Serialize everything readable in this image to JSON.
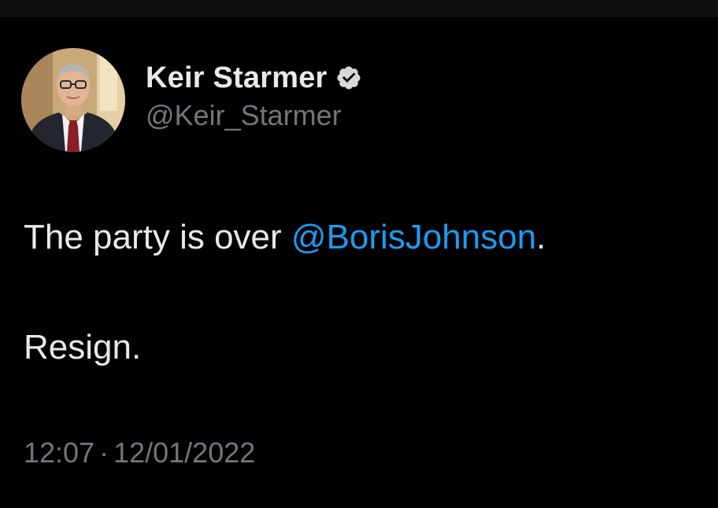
{
  "tweet": {
    "author": {
      "display_name": "Keir Starmer",
      "handle": "@Keir_Starmer",
      "verified": true,
      "avatar": "profile-photo"
    },
    "text": {
      "line1_prefix": "The party is over ",
      "mention": "@BorisJohnson",
      "line1_suffix": ".",
      "line2": "Resign."
    },
    "meta": {
      "time": "12:07",
      "separator": "·",
      "date": "12/01/2022"
    }
  },
  "colors": {
    "background": "#000000",
    "text": "#e7e9ea",
    "secondary": "#71767b",
    "link": "#1d9bf0",
    "verified_badge": "#d9d9d9"
  }
}
